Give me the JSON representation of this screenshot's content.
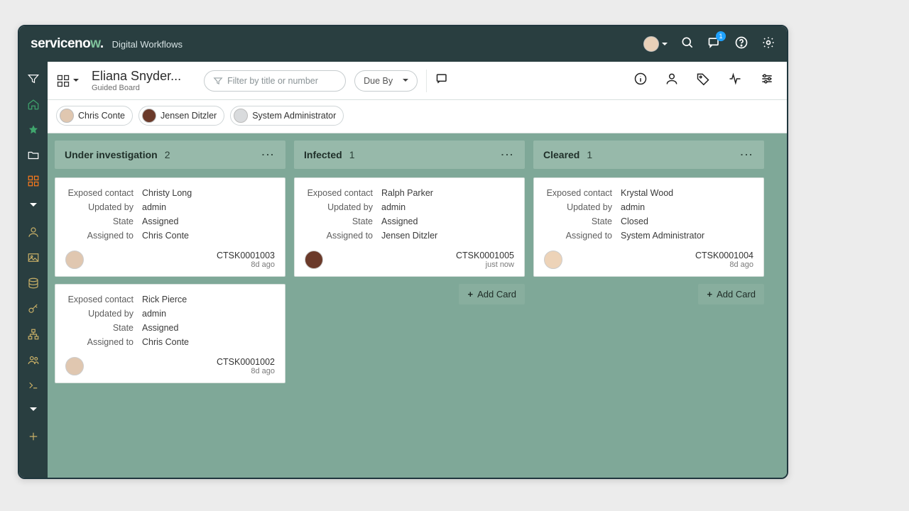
{
  "banner": {
    "brand": "servicenow",
    "tagline": "Digital Workflows",
    "chat_badge": "1"
  },
  "toolbar": {
    "board_title": "Eliana Snyder...",
    "board_subtitle": "Guided Board",
    "filter_placeholder": "Filter by title or number",
    "sort_label": "Due By"
  },
  "assignees": [
    {
      "name": "Chris Conte",
      "avatar_bg": "#e0c7b0"
    },
    {
      "name": "Jensen Ditzler",
      "avatar_bg": "#6b3a2a"
    },
    {
      "name": "System Administrator",
      "avatar_bg": "#d9dbdd"
    }
  ],
  "fields": {
    "f0": "Exposed contact",
    "f1": "Updated by",
    "f2": "State",
    "f3": "Assigned to"
  },
  "add_card_label": "Add Card",
  "lanes": [
    {
      "title": "Under investigation",
      "count": "2",
      "cards": [
        {
          "values": [
            "Christy Long",
            "admin",
            "Assigned",
            "Chris Conte"
          ],
          "id": "CTSK0001003",
          "age": "8d ago",
          "avatar_bg": "#e0c7b0"
        },
        {
          "values": [
            "Rick Pierce",
            "admin",
            "Assigned",
            "Chris Conte"
          ],
          "id": "CTSK0001002",
          "age": "8d ago",
          "avatar_bg": "#e0c7b0"
        }
      ]
    },
    {
      "title": "Infected",
      "count": "1",
      "cards": [
        {
          "values": [
            "Ralph Parker",
            "admin",
            "Assigned",
            "Jensen Ditzler"
          ],
          "id": "CTSK0001005",
          "age": "just now",
          "avatar_bg": "#6b3a2a"
        }
      ]
    },
    {
      "title": "Cleared",
      "count": "1",
      "cards": [
        {
          "values": [
            "Krystal Wood",
            "admin",
            "Closed",
            "System Administrator"
          ],
          "id": "CTSK0001004",
          "age": "8d ago",
          "avatar_bg": "#edd3b8"
        }
      ]
    }
  ]
}
